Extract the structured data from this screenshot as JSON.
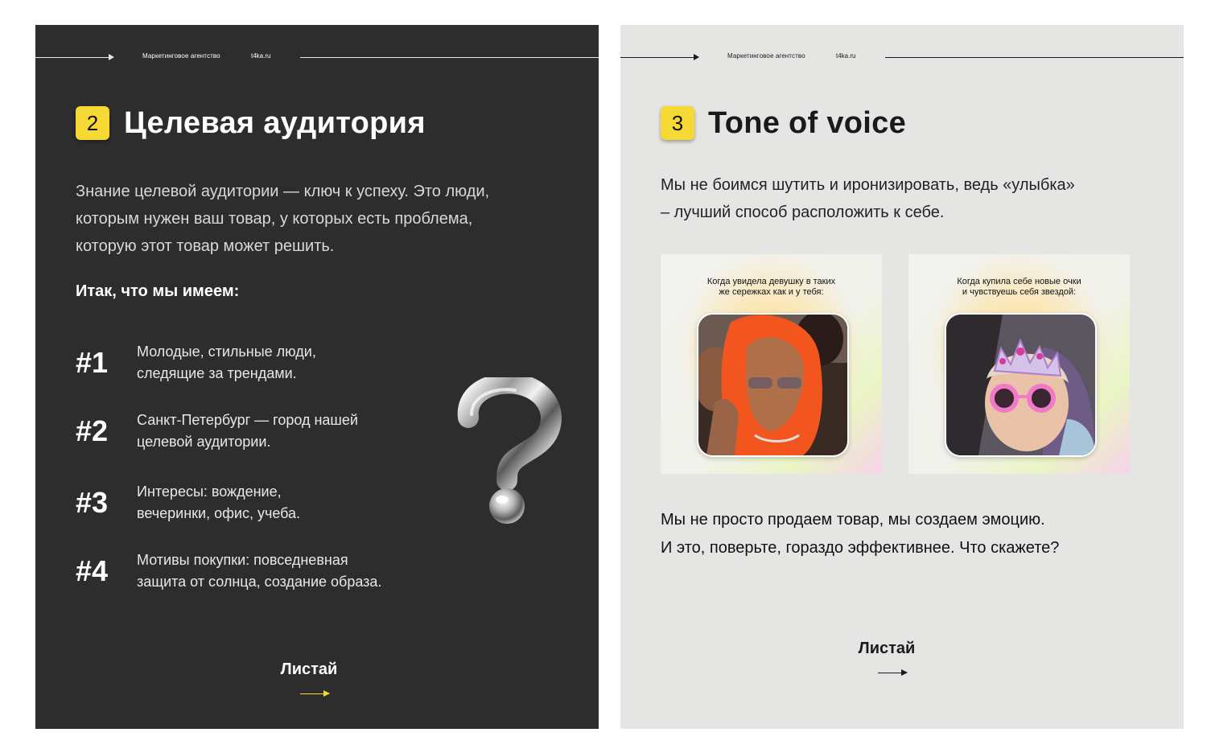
{
  "slides": [
    {
      "header": {
        "agency": "Маркетинговое агентство",
        "site": "t4ka.ru"
      },
      "number": "2",
      "title": "Целевая аудитория",
      "intro_lines": [
        "Знание целевой аудитории — ключ к успеху. Это люди,",
        "которым нужен ваш товар, у которых есть проблема,",
        "которую этот товар может решить."
      ],
      "subheading": "Итак, что мы имеем:",
      "items": [
        {
          "num": "#1",
          "line1": "Молодые, стильные люди,",
          "line2": "следящие за трендами."
        },
        {
          "num": "#2",
          "line1": "Санкт-Петербург — город нашей",
          "line2": "целевой аудитории."
        },
        {
          "num": "#3",
          "line1": "Интересы: вождение,",
          "line2": "вечеринки, офис, учеба."
        },
        {
          "num": "#4",
          "line1": "Мотивы покупки: повседневная",
          "line2": "защита от солнца, создание образа."
        }
      ],
      "decor_icon": "question-mark-3d-icon",
      "cta": "Листай",
      "cta_arrow_color": "#f7d935"
    },
    {
      "header": {
        "agency": "Маркетинговое агентство",
        "site": "t4ka.ru"
      },
      "number": "3",
      "title": "Tone of voice",
      "intro_lines": [
        "Мы не боимся шутить и иронизировать, ведь «улыбка»",
        "– лучший способ расположить к себе."
      ],
      "memes": [
        {
          "caption_line1": "Когда увидела девушку в таких",
          "caption_line2": "же сережках как и у тебя:"
        },
        {
          "caption_line1": "Когда купила себе новые очки",
          "caption_line2": "и чувствуешь себя звездой:"
        }
      ],
      "closing_lines": [
        "Мы не просто продаем товар, мы создаем эмоцию.",
        "И это, поверьте, гораздо эффективнее. Что скажете?"
      ],
      "cta": "Листай",
      "cta_arrow_color": "#1a1a1a"
    }
  ],
  "colors": {
    "dark_bg": "#2d2d2d",
    "light_bg": "#e5e5e3",
    "accent": "#f7d935"
  }
}
